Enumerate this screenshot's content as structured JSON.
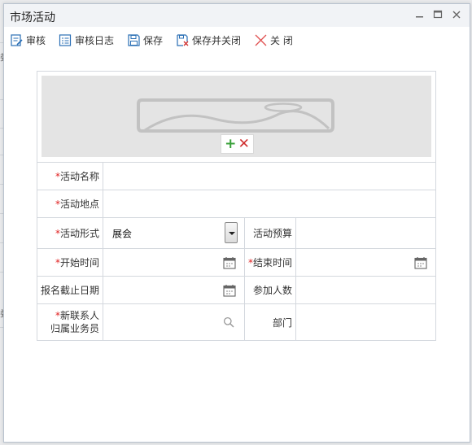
{
  "window": {
    "title": "市场活动"
  },
  "toolbar": {
    "audit_label": "审核",
    "audit_log_label": "审核日志",
    "save_label": "保存",
    "save_close_label": "保存并关闭",
    "close_label": "关 闭"
  },
  "form": {
    "required_mark": "*",
    "activity_name_label": "活动名称",
    "activity_name_value": "",
    "location_label": "活动地点",
    "location_value": "",
    "form_type_label": "活动形式",
    "form_type_value": "展会",
    "budget_label": "活动预算",
    "budget_value": "",
    "start_time_label": "开始时间",
    "start_time_value": "",
    "end_time_label": "结束时间",
    "end_time_value": "",
    "signup_deadline_label": "报名截止日期",
    "signup_deadline_value": "",
    "participants_label": "参加人数",
    "participants_value": "",
    "contact_label_line1": "新联系人",
    "contact_label_line2": "归属业务员",
    "contact_value": "",
    "department_label": "部门",
    "department_value": ""
  },
  "image_actions": {
    "add_glyph": "+",
    "remove_glyph": "✕"
  },
  "background": {
    "peek_chars": [
      "娄",
      "娄"
    ]
  },
  "colors": {
    "required": "#e02020",
    "add": "#3aa13a",
    "remove": "#d03030",
    "toolbar_icon": "#2a6fb5"
  }
}
